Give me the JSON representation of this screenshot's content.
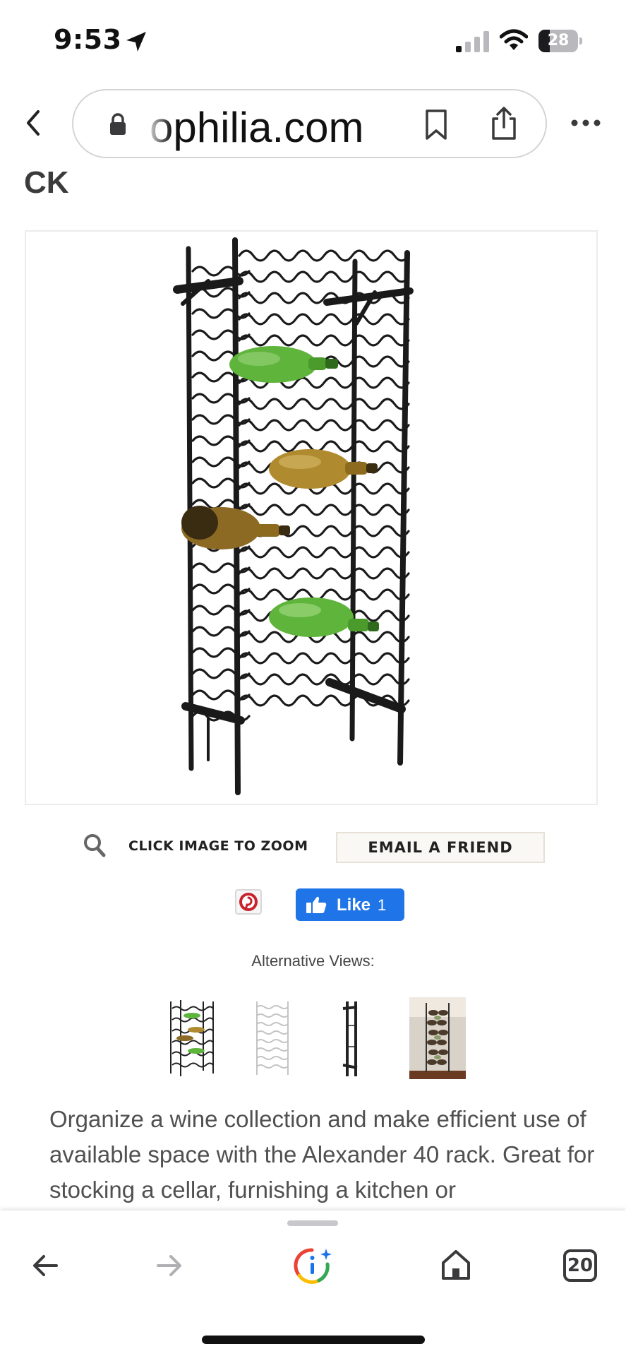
{
  "status_bar": {
    "time": "9:53",
    "battery": "28",
    "battery_level_percent": 28,
    "icons": [
      "location-arrow-icon",
      "cellular-signal-icon",
      "wifi-icon",
      "battery-icon"
    ]
  },
  "browser": {
    "url": "ophilia.com",
    "icons": [
      "back-chevron-icon",
      "lock-icon",
      "bookmark-icon",
      "share-icon",
      "more-icon"
    ]
  },
  "page": {
    "heading": "CK",
    "zoom_label": "CLICK IMAGE TO ZOOM",
    "email_button": "EMAIL A FRIEND",
    "like_label": "Like",
    "like_count": "1",
    "alt_views_label": "Alternative Views:",
    "description": "Organize a wine collection and make efficient use of available space with the Alexander 40 rack. Great for stocking a cellar, furnishing a kitchen or"
  },
  "toolbar": {
    "tabs_count": "20",
    "icons": [
      "back-arrow-icon",
      "forward-arrow-icon",
      "assistant-icon",
      "home-icon",
      "tabs-icon"
    ]
  },
  "colors": {
    "like_blue": "#1f74e8",
    "pinterest_red": "#c8232c",
    "bottle_green": "#5fb43c",
    "bottle_amber": "#b08a2e"
  }
}
